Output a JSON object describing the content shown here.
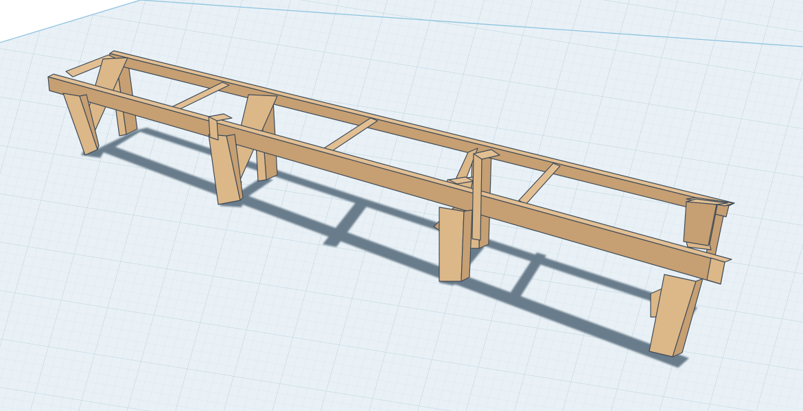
{
  "scene": {
    "object": "timber-frame-bench",
    "colors": {
      "background": "#ffffff",
      "workplane": "#e9f1f6",
      "grid_minor": "#d2e2ec",
      "grid_major": "#bdd3e1",
      "workplane_edge": "#8fc3df",
      "shadow": "#5b6f80",
      "wood_top": "#e2bf93",
      "wood_side": "#c69f72",
      "wood_end": "#dcb788",
      "wood_edge": "#3d4a57"
    }
  }
}
